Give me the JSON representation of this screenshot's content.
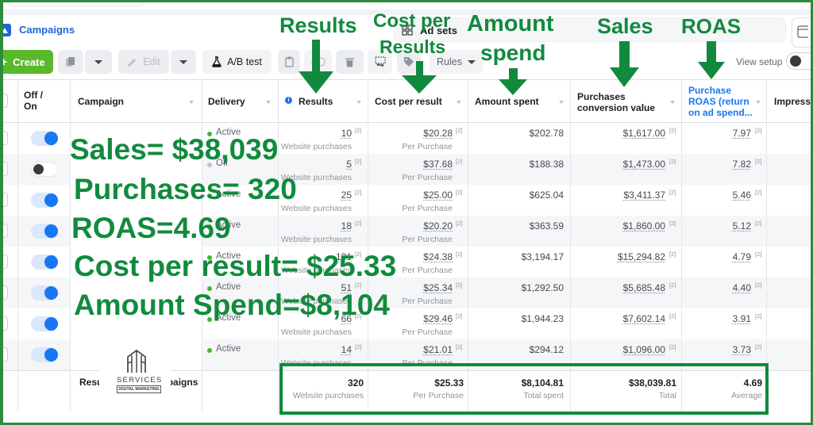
{
  "header": {
    "campaigns_tab": "Campaigns",
    "ad_sets_tab": "Ad sets"
  },
  "toolbar": {
    "create": "Create",
    "edit": "Edit",
    "ab_test": "A/B test",
    "rules": "Rules",
    "view_setup": "View setup"
  },
  "table": {
    "columns": {
      "off_on": "Off / On",
      "campaign": "Campaign",
      "delivery": "Delivery",
      "results": "Results",
      "cost_per_result": "Cost per result",
      "amount_spent": "Amount spent",
      "conversion_value": "Purchases conversion value",
      "roas": "Purchase ROAS (return on ad spend...",
      "impressions": "Impressions"
    },
    "footnote": "[2]",
    "rows": [
      {
        "on": true,
        "delivery": "Active",
        "results": "10",
        "results_type": "Website purchases",
        "cost_per_result": "$20.28",
        "cost_unit": "Per Purchase",
        "amount_spent": "$202.78",
        "conversion_value": "$1,617.00",
        "roas": "7.97"
      },
      {
        "on": false,
        "delivery": "Off",
        "results": "5",
        "results_type": "Website purchases",
        "cost_per_result": "$37.68",
        "cost_unit": "Per Purchase",
        "amount_spent": "$188.38",
        "conversion_value": "$1,473.00",
        "roas": "7.82"
      },
      {
        "on": true,
        "delivery": "Active",
        "results": "25",
        "results_type": "Website purchases",
        "cost_per_result": "$25.00",
        "cost_unit": "Per Purchase",
        "amount_spent": "$625.04",
        "conversion_value": "$3,411.37",
        "roas": "5.46"
      },
      {
        "on": true,
        "delivery": "Active",
        "results": "18",
        "results_type": "Website purchases",
        "cost_per_result": "$20.20",
        "cost_unit": "Per Purchase",
        "amount_spent": "$363.59",
        "conversion_value": "$1,860.00",
        "roas": "5.12"
      },
      {
        "on": true,
        "delivery": "Active",
        "results": "131",
        "results_type": "Website purchases",
        "cost_per_result": "$24.38",
        "cost_unit": "Per Purchase",
        "amount_spent": "$3,194.17",
        "conversion_value": "$15,294.82",
        "roas": "4.79"
      },
      {
        "on": true,
        "delivery": "Active",
        "results": "51",
        "results_type": "Website purchases",
        "cost_per_result": "$25.34",
        "cost_unit": "Per Purchase",
        "amount_spent": "$1,292.50",
        "conversion_value": "$5,685.48",
        "roas": "4.40"
      },
      {
        "on": true,
        "delivery": "Active",
        "results": "66",
        "results_type": "Website purchases",
        "cost_per_result": "$29.46",
        "cost_unit": "Per Purchase",
        "amount_spent": "$1,944.23",
        "conversion_value": "$7,602.14",
        "roas": "3.91"
      },
      {
        "on": true,
        "delivery": "Active",
        "results": "14",
        "results_type": "Website purchases",
        "cost_per_result": "$21.01",
        "cost_unit": "Per Purchase",
        "amount_spent": "$294.12",
        "conversion_value": "$1,096.00",
        "roas": "3.73"
      }
    ],
    "footer": {
      "label": "Results from 8 campaigns",
      "results": "320",
      "results_sub": "Website purchases",
      "cost_per_result": "$25.33",
      "cost_per_result_sub": "Per Purchase",
      "amount_spent": "$8,104.81",
      "amount_spent_sub": "Total spent",
      "conversion_value": "$38,039.81",
      "conversion_value_sub": "Total",
      "roas": "4.69",
      "roas_sub": "Average"
    }
  },
  "annotations": {
    "results": "Results",
    "cost_per_results_line1": "Cost per",
    "cost_per_results_line2": "Results",
    "amount_spend_line1": "Amount",
    "amount_spend_line2": "spend",
    "sales": "Sales",
    "roas": "ROAS",
    "summary": [
      "Sales= $38,039",
      "Purchases= 320",
      "ROAS=4.69",
      "Cost per result= $25.33",
      "Amount Spend=$8,104"
    ]
  },
  "logo": {
    "name": "SERVICES",
    "tagline": "DIGITAL MARKETING"
  },
  "colors": {
    "accent_blue": "#1877f2",
    "create_green": "#5ab82b",
    "active_green": "#42b72a",
    "annotation_green": "#128a3e",
    "frame_green": "#2e8b3c"
  }
}
